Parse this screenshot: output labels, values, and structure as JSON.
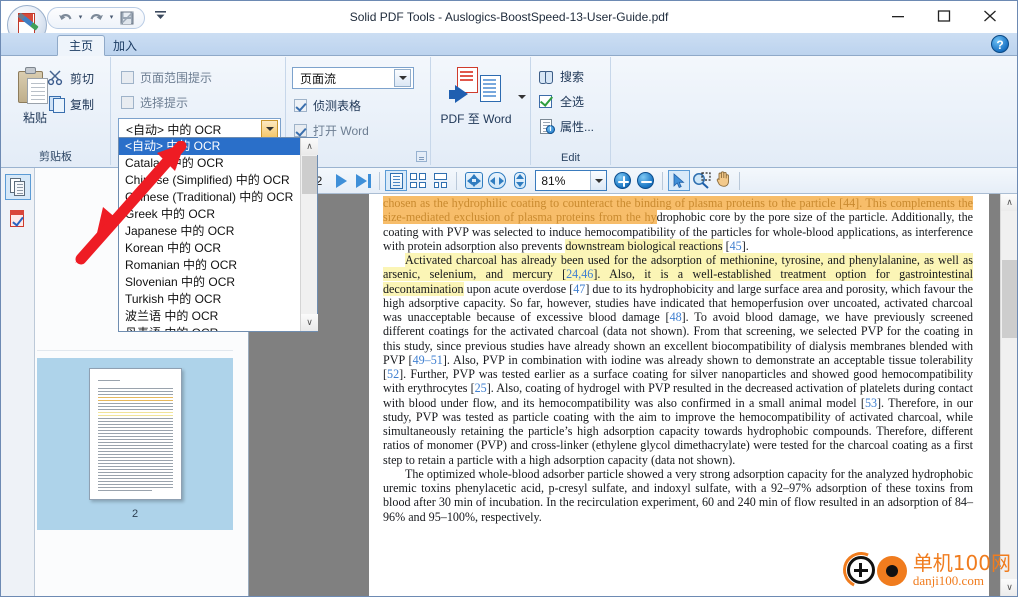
{
  "window": {
    "title": "Solid PDF Tools - Auslogics-BoostSpeed-13-User-Guide.pdf",
    "minimize": "─",
    "maximize": "□",
    "close": "✕"
  },
  "quick_access": {
    "undo": "undo-arrow",
    "redo": "redo-arrow",
    "save": "save-disk",
    "more": "☰"
  },
  "tabs": [
    {
      "label": "主页",
      "active": true
    },
    {
      "label": "加入",
      "active": false
    }
  ],
  "help": {
    "label": "?"
  },
  "ribbon": {
    "clipboard": {
      "group_label": "剪贴板",
      "paste": "粘贴",
      "cut": "剪切",
      "copy": "复制"
    },
    "options": {
      "page_range_prompt": "页面范围提示",
      "selection_prompt": "选择提示",
      "ocr_value": "<自动> 中的 OCR"
    },
    "flow": {
      "mode_value": "页面流",
      "detect_tables": "侦测表格",
      "open_word": "打开 Word"
    },
    "convert": {
      "pdf_to_word": "PDF 至 Word"
    },
    "edit": {
      "group_label": "Edit",
      "search": "搜索",
      "select_all": "全选",
      "properties": "属性..."
    }
  },
  "ocr_dropdown": {
    "items": [
      "<自动> 中的 OCR",
      "Catalan 中的 OCR",
      "Chinese (Simplified) 中的 OCR",
      "Chinese (Traditional) 中的 OCR",
      "Greek 中的 OCR",
      "Japanese 中的 OCR",
      "Korean 中的 OCR",
      "Romanian 中的 OCR",
      "Slovenian 中的 OCR",
      "Turkish 中的 OCR",
      "波兰语 中的 OCR",
      "丹麦语 中的 OCR"
    ],
    "selected_index": 0,
    "scroll_up": "∧",
    "scroll_down": "∨"
  },
  "sidebar": {
    "pages_tab": "pages-panel",
    "marks_tab": "marks-panel",
    "thumbnail_page_number": "2"
  },
  "doc_toolbar": {
    "page_value": "",
    "page_total": "/ 2",
    "next_page": "next-page",
    "last_page": "last-page",
    "view_single": "single-page-view",
    "view_grid": "grid-view",
    "view_continuous": "continuous-view",
    "fit_page": "fit-page",
    "fit_width": "fit-width",
    "fit_height": "fit-height",
    "zoom_value": "81%",
    "zoom_in": "+",
    "zoom_out": "−",
    "select_tool": "select-tool",
    "zoom_select_tool": "zoom-select-tool",
    "hand_tool": "hand-tool"
  },
  "document": {
    "paragraphs": [
      {
        "indent": false,
        "runs": [
          {
            "text": "chosen as the hydrophilic coating to counteract the binding of plasma proteins to the particle [44]. This complements the size-mediated exclusion of plasma proteins from the hy",
            "style": "hl-o"
          },
          {
            "text": "drophobic core by the pore size of the particle. Additionally, the coating with PVP was selected to induce hemocompatibility of the particles for whole-blood applications, as interference with protein adsorption also prevents ",
            "style": ""
          },
          {
            "text": "downstream biological reactions",
            "style": "hl-y"
          },
          {
            "text": " [",
            "style": ""
          },
          {
            "text": "45",
            "style": "ref"
          },
          {
            "text": "].",
            "style": ""
          }
        ]
      },
      {
        "indent": true,
        "runs": [
          {
            "text": "Activated charcoal has already been used for the adsorption of methionine, tyrosine, and phenylalanine, as well as arsenic, selenium, and mercury [",
            "style": "hl-y"
          },
          {
            "text": "24,46",
            "style": "ref hl-y"
          },
          {
            "text": "]. Also, it is a well-established treatment option for gastrointestinal decontamination",
            "style": "hl-y"
          },
          {
            "text": " upon acute overdose [",
            "style": ""
          },
          {
            "text": "47",
            "style": "ref"
          },
          {
            "text": "] due to its hydrophobicity and large surface area and porosity, which favour the high adsorptive capacity. So far, however, studies have indicated that hemoperfusion over uncoated, activated charcoal was unacceptable because of excessive blood damage [",
            "style": ""
          },
          {
            "text": "48",
            "style": "ref"
          },
          {
            "text": "]. To avoid blood damage, we have previously screened different coatings for the activated charcoal (data not shown). From that screening, we selected PVP for the coating in this study, since previous studies have already shown an excellent biocompatibility of dialysis membranes blended with PVP [",
            "style": ""
          },
          {
            "text": "49–51",
            "style": "ref"
          },
          {
            "text": "]. Also, PVP in combination with iodine was already shown to demonstrate an acceptable tissue tolerability [",
            "style": ""
          },
          {
            "text": "52",
            "style": "ref"
          },
          {
            "text": "]. Further, PVP was tested earlier as a surface coating for silver nanoparticles and showed good hemocompatibility with erythrocytes [",
            "style": ""
          },
          {
            "text": "25",
            "style": "ref"
          },
          {
            "text": "]. Also, coating of hydrogel with PVP resulted in the decreased activation of platelets during contact with blood under flow, and its hemocompatibility was also confirmed in a small animal model [",
            "style": ""
          },
          {
            "text": "53",
            "style": "ref"
          },
          {
            "text": "]. Therefore, in our study, PVP was tested as particle coating with the aim to improve the hemocompatibility of activated charcoal, while simultaneously retaining the particle’s high adsorption capacity towards hydrophobic compounds. Therefore, different ratios of monomer (PVP) and cross-linker (ethylene glycol dimethacrylate) were tested for the charcoal coating as a first step to retain a particle with a high adsorption capacity (data not shown).",
            "style": ""
          }
        ]
      },
      {
        "indent": true,
        "runs": [
          {
            "text": "The optimized whole-blood adsorber particle showed a very strong adsorption capacity for the analyzed hydrophobic uremic toxins phenylacetic acid, p-cresyl sulfate, and indoxyl sulfate, with a 92–97% adsorption of these toxins from blood after 30 min of incubation. In the recirculation experiment, 60 and 240 min of flow resulted in an adsorption of 84–96% and 95–100%, respectively.",
            "style": ""
          }
        ]
      }
    ]
  },
  "watermark": {
    "cn": "单机100网",
    "en": "danji100.com"
  },
  "scrollbars": {
    "up": "∧",
    "down": "∨"
  },
  "colors": {
    "accent": "#2a6fc9",
    "highlight_yellow": "#fbf5b6",
    "highlight_orange": "#f7bd6a",
    "reference_blue": "#3f7fd0",
    "watermark_orange": "#f07c1e"
  }
}
